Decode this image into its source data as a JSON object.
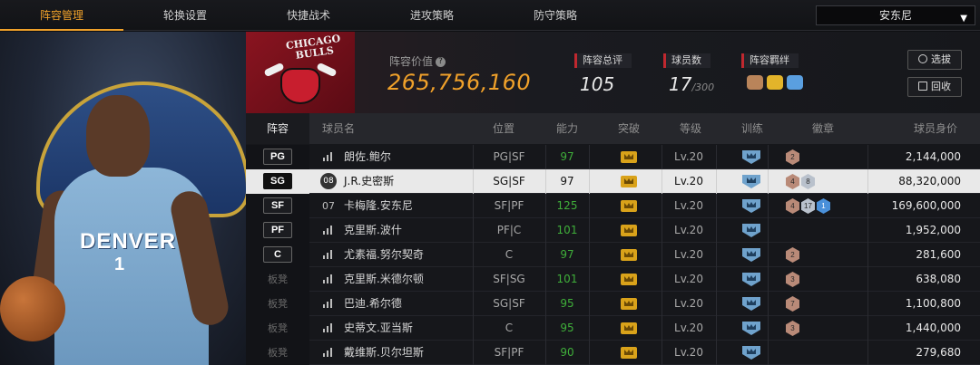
{
  "nav": {
    "tabs": [
      {
        "label": "阵容管理",
        "active": true
      },
      {
        "label": "轮换设置",
        "active": false
      },
      {
        "label": "快捷战术",
        "active": false
      },
      {
        "label": "进攻策略",
        "active": false
      },
      {
        "label": "防守策略",
        "active": false
      }
    ],
    "team_select": "安东尼"
  },
  "left_art": {
    "jersey_text": "DENVER",
    "jersey_number": "1"
  },
  "header": {
    "logo_text": "CHICAGO BULLS",
    "lineup_value_label": "阵容价值",
    "lineup_value": "265,756,160",
    "rating_label": "阵容总评",
    "rating_value": "105",
    "count_label": "球员数",
    "count_value": "17",
    "count_max": "/300",
    "synergy_label": "阵容羁绊",
    "select_btn": "选拔",
    "recycle_btn": "回收"
  },
  "table": {
    "headers": {
      "lineup": "阵容",
      "player": "球员名",
      "position": "位置",
      "ability": "能力",
      "breakthrough": "突破",
      "level": "等级",
      "training": "训练",
      "badges": "徽章",
      "salary": "球员身价"
    },
    "rows": [
      {
        "slot": "PG",
        "bench": false,
        "number": "",
        "name": "朗佐.鲍尔",
        "position": "PG|SF",
        "ability": "97",
        "level": "Lv.20",
        "badges": [
          {
            "t": "2",
            "c": "bronze"
          }
        ],
        "salary": "2,144,000"
      },
      {
        "slot": "SG",
        "bench": false,
        "number": "08",
        "name": "J.R.史密斯",
        "position": "SG|SF",
        "ability": "97",
        "level": "Lv.20",
        "badges": [
          {
            "t": "4",
            "c": "bronze"
          },
          {
            "t": "8",
            "c": "silver"
          }
        ],
        "salary": "88,320,000",
        "selected": true
      },
      {
        "slot": "SF",
        "bench": false,
        "number": "07",
        "name": "卡梅隆.安东尼",
        "position": "SF|PF",
        "ability": "125",
        "level": "Lv.20",
        "badges": [
          {
            "t": "4",
            "c": "bronze"
          },
          {
            "t": "17",
            "c": "silver"
          },
          {
            "t": "1",
            "c": "blue"
          }
        ],
        "salary": "169,600,000"
      },
      {
        "slot": "PF",
        "bench": false,
        "number": "",
        "name": "克里斯.波什",
        "position": "PF|C",
        "ability": "101",
        "level": "Lv.20",
        "badges": [],
        "salary": "1,952,000"
      },
      {
        "slot": "C",
        "bench": false,
        "number": "",
        "name": "尤素福.努尔契奇",
        "position": "C",
        "ability": "97",
        "level": "Lv.20",
        "badges": [
          {
            "t": "2",
            "c": "bronze"
          }
        ],
        "salary": "281,600"
      },
      {
        "slot": "板凳",
        "bench": true,
        "number": "",
        "name": "克里斯.米德尔顿",
        "position": "SF|SG",
        "ability": "101",
        "level": "Lv.20",
        "badges": [
          {
            "t": "3",
            "c": "bronze"
          }
        ],
        "salary": "638,080"
      },
      {
        "slot": "板凳",
        "bench": true,
        "number": "",
        "name": "巴迪.希尔德",
        "position": "SG|SF",
        "ability": "95",
        "level": "Lv.20",
        "badges": [
          {
            "t": "7",
            "c": "bronze"
          }
        ],
        "salary": "1,100,800"
      },
      {
        "slot": "板凳",
        "bench": true,
        "number": "",
        "name": "史蒂文.亚当斯",
        "position": "C",
        "ability": "95",
        "level": "Lv.20",
        "badges": [
          {
            "t": "3",
            "c": "bronze"
          }
        ],
        "salary": "1,440,000"
      },
      {
        "slot": "板凳",
        "bench": true,
        "number": "",
        "name": "戴维斯.贝尔坦斯",
        "position": "SF|PF",
        "ability": "90",
        "level": "Lv.20",
        "badges": [],
        "salary": "279,680"
      }
    ]
  },
  "colors": {
    "accent": "#f0a12a",
    "ability_green": "#3fae3a",
    "red_marker": "#c0282f"
  }
}
